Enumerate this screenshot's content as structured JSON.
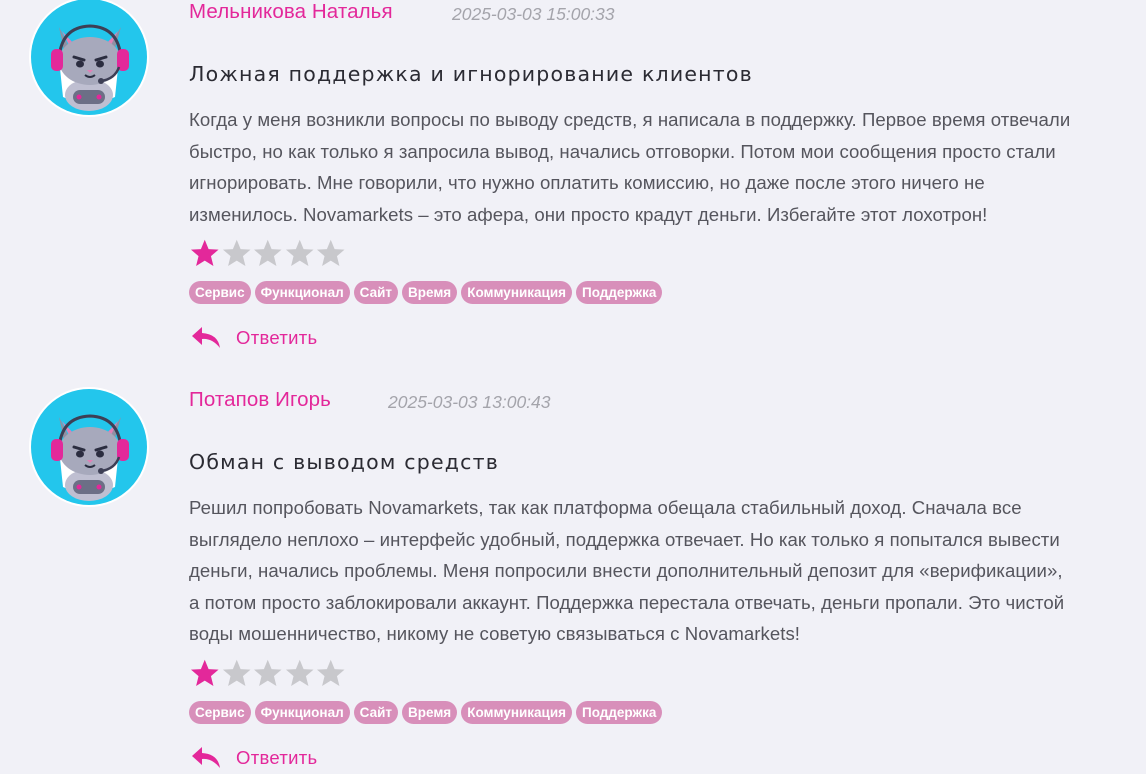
{
  "reviews": [
    {
      "author": "Мельникова Наталья",
      "datetime": "2025-03-03 15:00:33",
      "title": "Ложная поддержка и игнорирование клиентов",
      "body_lines": [
        "Когда у меня возникли вопросы по выводу средств, я написала в поддержку. Первое время отвечали",
        "быстро, но как только я запросила вывод, начались отговорки. Потом мои сообщения просто стали",
        "игнорировать. Мне говорили, что нужно оплатить комиссию, но даже после этого ничего не",
        "изменилось. Novamarkets – это афера, они просто крадут деньги. Избегайте этот лохотрон!"
      ],
      "rating": 1,
      "rating_max": 5,
      "tags": [
        "Сервис",
        "Функционал",
        "Сайт",
        "Время",
        "Коммуникация",
        "Поддержка"
      ],
      "reply_label": "Ответить"
    },
    {
      "author": "Потапов Игорь",
      "datetime": "2025-03-03 13:00:43",
      "title": "Обман с выводом средств",
      "body_lines": [
        "Решил попробовать Novamarkets, так как платформа обещала стабильный доход. Сначала все",
        "выглядело неплохо – интерфейс удобный, поддержка отвечает. Но как только я попытался вывести",
        "деньги, начались проблемы. Меня попросили внести дополнительный депозит для «верификации»,",
        "а потом просто заблокировали аккаунт. Поддержка перестала отвечать, деньги пропали. Это чистой",
        "воды мошенничество, никому не советую связываться с Novamarkets!"
      ],
      "rating": 1,
      "rating_max": 5,
      "tags": [
        "Сервис",
        "Функционал",
        "Сайт",
        "Время",
        "Коммуникация",
        "Поддержка"
      ],
      "reply_label": "Ответить"
    }
  ],
  "icons": {
    "avatar": "cat-gamer-avatar-icon",
    "star": "star-icon",
    "reply": "reply-arrow-icon"
  },
  "colors": {
    "accent": "#e3289a",
    "star_filled": "#e3289a",
    "star_empty": "#c8c8cc",
    "tag_bg": "#d88fba",
    "background": "#f1f1f7",
    "avatar_ring": "#23c6ec"
  }
}
